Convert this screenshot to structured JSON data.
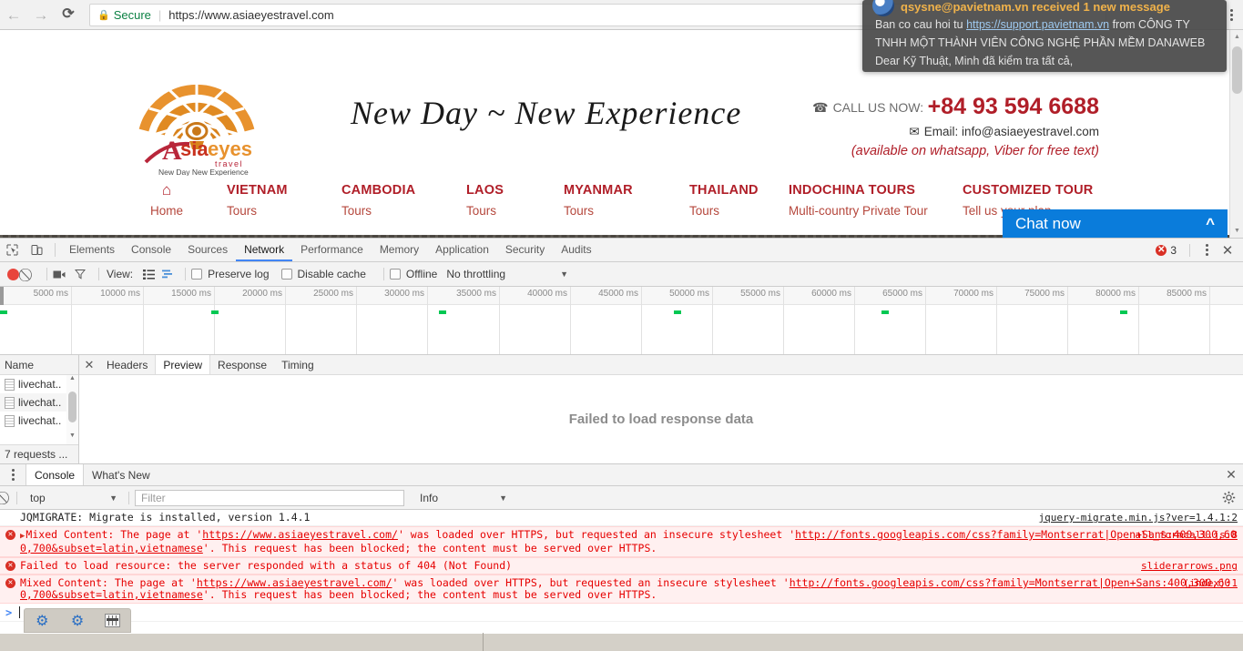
{
  "browser": {
    "back_icon": "back-arrow-icon",
    "forward_icon": "forward-arrow-icon",
    "reload_icon": "reload-icon",
    "lock_icon": "lock-icon",
    "secure_label": "Secure",
    "url": "https://www.asiaeyestravel.com",
    "menu_icon": "chrome-menu-icon"
  },
  "notification": {
    "title": "qsysne@pavietnam.vn received 1 new message",
    "line1_pre": "Ban co cau hoi tu ",
    "line1_link": "https://support.pavietnam.vn",
    "line1_post": " from CÔNG TY",
    "line2": "TNHH MỘT THÀNH VIÊN CÔNG NGHỆ PHẦN MỀM DANAWEB",
    "line3": "Dear Kỹ Thuật, Minh đã kiểm tra tất cả,"
  },
  "site": {
    "logo_name": "Asiaeyes travel",
    "logo_tagline": "New Day New Experience",
    "slogan": "New Day ~ New Experience",
    "call_label": "CALL US NOW:",
    "phone": "+84 93 594 6688",
    "email_label": "Email:",
    "email": "info@asiaeyestravel.com",
    "whatsapp_note": "(available on whatsapp, Viber for free text)",
    "nav": [
      {
        "top": "",
        "sub": "Home",
        "icon": "home-icon"
      },
      {
        "top": "VIETNAM",
        "sub": "Tours"
      },
      {
        "top": "CAMBODIA",
        "sub": "Tours"
      },
      {
        "top": "LAOS",
        "sub": "Tours"
      },
      {
        "top": "MYANMAR",
        "sub": "Tours"
      },
      {
        "top": "THAILAND",
        "sub": "Tours"
      },
      {
        "top": "INDOCHINA TOURS",
        "sub": "Multi-country Private Tour"
      },
      {
        "top": "CUSTOMIZED TOUR",
        "sub": "Tell us your plan"
      }
    ],
    "chat_label": "Chat now",
    "chat_caret": "chevron-up-icon",
    "accent_red": "#b01e28",
    "chat_blue": "#0a7cdb"
  },
  "devtools": {
    "tabs": [
      "Elements",
      "Console",
      "Sources",
      "Network",
      "Performance",
      "Memory",
      "Application",
      "Security",
      "Audits"
    ],
    "active_tab": "Network",
    "inspect_icon": "inspect-element-icon",
    "device_icon": "device-toolbar-icon",
    "error_count": "3",
    "more_icon": "kebab-menu-icon",
    "close_icon": "close-icon",
    "toolbar": {
      "record_icon": "record-stop-icon",
      "clear_icon": "clear-icon",
      "camera_icon": "capture-screenshots-icon",
      "filter_icon": "filter-icon",
      "view_label": "View:",
      "list_view_icon": "list-view-icon",
      "waterfall_view_icon": "waterfall-view-icon",
      "preserve_log": "Preserve log",
      "disable_cache": "Disable cache",
      "offline": "Offline",
      "throttling": "No throttling",
      "throttle_caret": "chevron-down-icon"
    },
    "timeline": {
      "ticks": [
        "5000 ms",
        "10000 ms",
        "15000 ms",
        "20000 ms",
        "25000 ms",
        "30000 ms",
        "35000 ms",
        "40000 ms",
        "45000 ms",
        "50000 ms",
        "55000 ms",
        "60000 ms",
        "65000 ms",
        "70000 ms",
        "75000 ms",
        "80000 ms",
        "85000 ms"
      ],
      "marker_color": "#00c853"
    },
    "requests": {
      "column_header": "Name",
      "rows": [
        "livechat..",
        "livechat..",
        "livechat.."
      ],
      "footer": "7 requests  ...",
      "row_icon": "document-icon"
    },
    "detail": {
      "close_icon": "close-icon",
      "tabs": [
        "Headers",
        "Preview",
        "Response",
        "Timing"
      ],
      "active_tab": "Preview",
      "empty_message": "Failed to load response data"
    }
  },
  "drawer": {
    "kebab_icon": "kebab-menu-icon",
    "tabs": [
      "Console",
      "What's New"
    ],
    "active_tab": "Console",
    "close_icon": "close-icon",
    "toolbar": {
      "clear_icon": "clear-console-icon",
      "context": "top",
      "context_caret": "chevron-down-icon",
      "filter_placeholder": "Filter",
      "level": "Info",
      "level_caret": "chevron-down-icon",
      "settings_icon": "gear-icon"
    },
    "messages": [
      {
        "type": "plain",
        "text": "JQMIGRATE: Migrate is installed, version 1.4.1",
        "source": "jquery-migrate.min.js?ver=1.4.1:2",
        "expandable": false
      },
      {
        "type": "error",
        "expandable": true,
        "text_pre": "Mixed Content: The page at '",
        "link1": "https://www.asiaeyestravel.com/",
        "text_mid": "' was loaded over HTTPS, but requested an insecure stylesheet '",
        "link2": "http://fonts.googleapis.com/css?family=Montserrat|Open+Sans:400,300,600,700&subset=latin,vietnamese",
        "text_post": "'. This request has been blocked; the content must be served over HTTPS.",
        "source": "all_formcall.js:8"
      },
      {
        "type": "error",
        "expandable": false,
        "text": "Failed to load resource: the server responded with a status of 404 (Not Found)",
        "source": "sliderarrows.png"
      },
      {
        "type": "error",
        "expandable": false,
        "text_pre": "Mixed Content: The page at '",
        "link1": "https://www.asiaeyestravel.com/",
        "text_mid": "' was loaded over HTTPS, but requested an insecure stylesheet '",
        "link2": "http://fonts.googleapis.com/css?family=Montserrat|Open+Sans:400,300,600,700&subset=latin,vietnamese",
        "text_post": "'. This request has been blocked; the content must be served over HTTPS.",
        "source": "(index):1"
      }
    ],
    "prompt_caret": "console-prompt-icon"
  },
  "taskbar": {
    "tray": [
      {
        "icon": "gear-icon"
      },
      {
        "icon": "gear-icon"
      },
      {
        "icon": "equalizer-icon"
      }
    ]
  }
}
